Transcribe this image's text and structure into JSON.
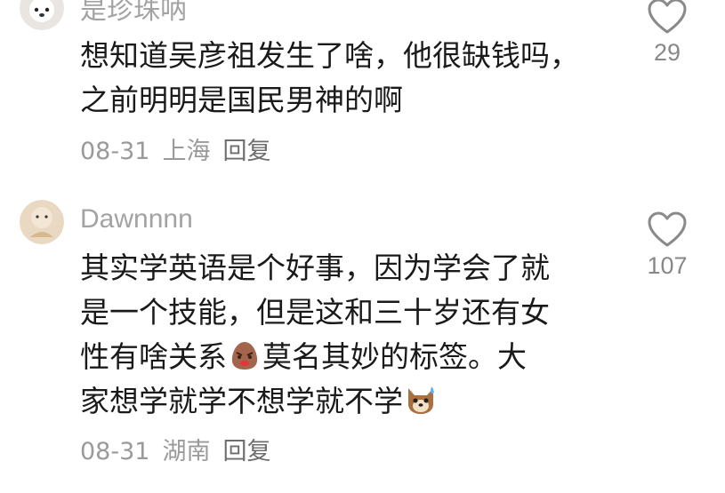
{
  "comments": [
    {
      "username": "是珍珠呐",
      "text": "想知道吴彦祖发生了啥，他很缺钱吗，\n之前明明是国民男神的啊",
      "date": "08-31",
      "location": "上海",
      "reply_label": "回复",
      "like_count": "29"
    },
    {
      "username": "Dawnnnn",
      "text_part1": "其实学英语是个好事，因为学会了就\n是一个技能，但是这和三十岁还有女\n性有啥关系",
      "emoji1": "angry-face-emoji",
      "text_part2": "莫名其妙的标签。大\n家想学就学不想学就不学",
      "emoji2": "dog-sweat-emoji",
      "date": "08-31",
      "location": "湖南",
      "reply_label": "回复",
      "like_count": "107"
    }
  ],
  "colors": {
    "text": "#1a1a1a",
    "username": "#a3a3a3",
    "meta": "#9a9a9a",
    "icon": "#8a8a8a"
  }
}
